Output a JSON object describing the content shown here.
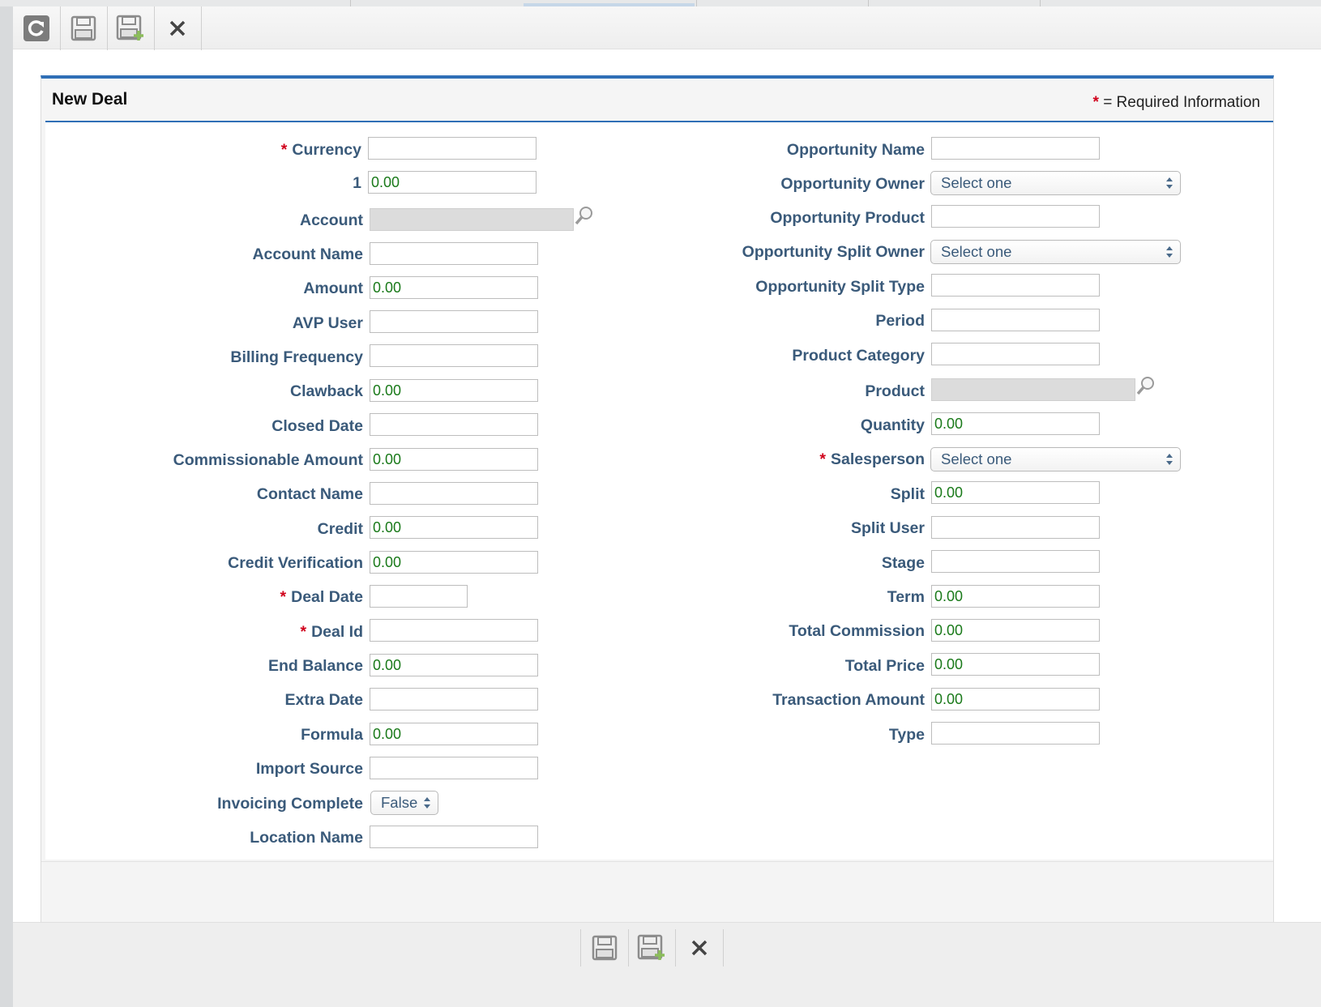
{
  "toolbar": {
    "refresh": "refresh-icon",
    "save": "save-icon",
    "save_new": "save-and-new-icon",
    "close": "close-icon"
  },
  "panel": {
    "title": "New Deal",
    "required_star": "*",
    "required_note": "= Required Information"
  },
  "left_fields": [
    {
      "label": "Currency",
      "required": true,
      "value": ""
    },
    {
      "label": "1",
      "required": false,
      "value": "0.00"
    },
    {
      "label": "Account",
      "required": false,
      "value": ""
    },
    {
      "label": "Account Name",
      "required": false,
      "value": ""
    },
    {
      "label": "Amount",
      "required": false,
      "value": "0.00"
    },
    {
      "label": "AVP User",
      "required": false,
      "value": ""
    },
    {
      "label": "Billing Frequency",
      "required": false,
      "value": ""
    },
    {
      "label": "Clawback",
      "required": false,
      "value": "0.00"
    },
    {
      "label": "Closed Date",
      "required": false,
      "value": ""
    },
    {
      "label": "Commissionable Amount",
      "required": false,
      "value": "0.00"
    },
    {
      "label": "Contact Name",
      "required": false,
      "value": ""
    },
    {
      "label": "Credit",
      "required": false,
      "value": "0.00"
    },
    {
      "label": "Credit Verification",
      "required": false,
      "value": "0.00"
    },
    {
      "label": "Deal Date",
      "required": true,
      "value": ""
    },
    {
      "label": "Deal Id",
      "required": true,
      "value": ""
    },
    {
      "label": "End Balance",
      "required": false,
      "value": "0.00"
    },
    {
      "label": "Extra Date",
      "required": false,
      "value": ""
    },
    {
      "label": "Formula",
      "required": false,
      "value": "0.00"
    },
    {
      "label": "Import Source",
      "required": false,
      "value": ""
    },
    {
      "label": "Invoicing Complete",
      "required": false,
      "value": "False"
    },
    {
      "label": "Location Name",
      "required": false,
      "value": ""
    }
  ],
  "right_fields": [
    {
      "label": "Opportunity Name",
      "required": false,
      "value": ""
    },
    {
      "label": "Opportunity Owner",
      "required": false,
      "value": "Select one"
    },
    {
      "label": "Opportunity Product",
      "required": false,
      "value": ""
    },
    {
      "label": "Opportunity Split Owner",
      "required": false,
      "value": "Select one"
    },
    {
      "label": "Opportunity Split Type",
      "required": false,
      "value": ""
    },
    {
      "label": "Period",
      "required": false,
      "value": ""
    },
    {
      "label": "Product Category",
      "required": false,
      "value": ""
    },
    {
      "label": "Product",
      "required": false,
      "value": ""
    },
    {
      "label": "Quantity",
      "required": false,
      "value": "0.00"
    },
    {
      "label": "Salesperson",
      "required": true,
      "value": "Select one"
    },
    {
      "label": "Split",
      "required": false,
      "value": "0.00"
    },
    {
      "label": "Split User",
      "required": false,
      "value": ""
    },
    {
      "label": "Stage",
      "required": false,
      "value": ""
    },
    {
      "label": "Term",
      "required": false,
      "value": "0.00"
    },
    {
      "label": "Total Commission",
      "required": false,
      "value": "0.00"
    },
    {
      "label": "Total Price",
      "required": false,
      "value": "0.00"
    },
    {
      "label": "Transaction Amount",
      "required": false,
      "value": "0.00"
    },
    {
      "label": "Type",
      "required": false,
      "value": ""
    }
  ],
  "colors": {
    "accent": "#2f6fb6",
    "label": "#3a5a7a",
    "value": "#1a7a1a",
    "required": "#d0021b"
  }
}
